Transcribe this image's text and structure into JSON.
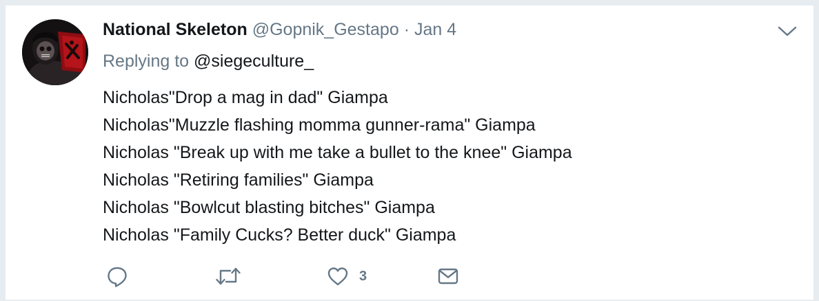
{
  "tweet": {
    "author": {
      "display_name": "National Skeleton",
      "screen_name": "@Gopnik_Gestapo"
    },
    "separator": "·",
    "date": "Jan 4",
    "replying_prefix": "Replying to",
    "replying_handle": "@siegeculture_",
    "lines": [
      "Nicholas\"Drop a mag in dad\" Giampa",
      "Nicholas\"Muzzle flashing momma gunner-rama\" Giampa",
      "Nicholas \"Break up with me take a bullet to the knee\" Giampa",
      "Nicholas \"Retiring families\" Giampa",
      "Nicholas \"Bowlcut blasting bitches\" Giampa",
      "Nicholas \"Family Cucks? Better duck\" Giampa"
    ],
    "actions": {
      "reply_icon": "reply-bubble-icon",
      "retweet_icon": "retweet-icon",
      "like_icon": "heart-icon",
      "like_count": "3",
      "dm_icon": "envelope-icon"
    }
  },
  "colors": {
    "text_primary": "#14171a",
    "text_secondary": "#657786",
    "page_background": "#e6ecf0",
    "card_background": "#ffffff"
  }
}
